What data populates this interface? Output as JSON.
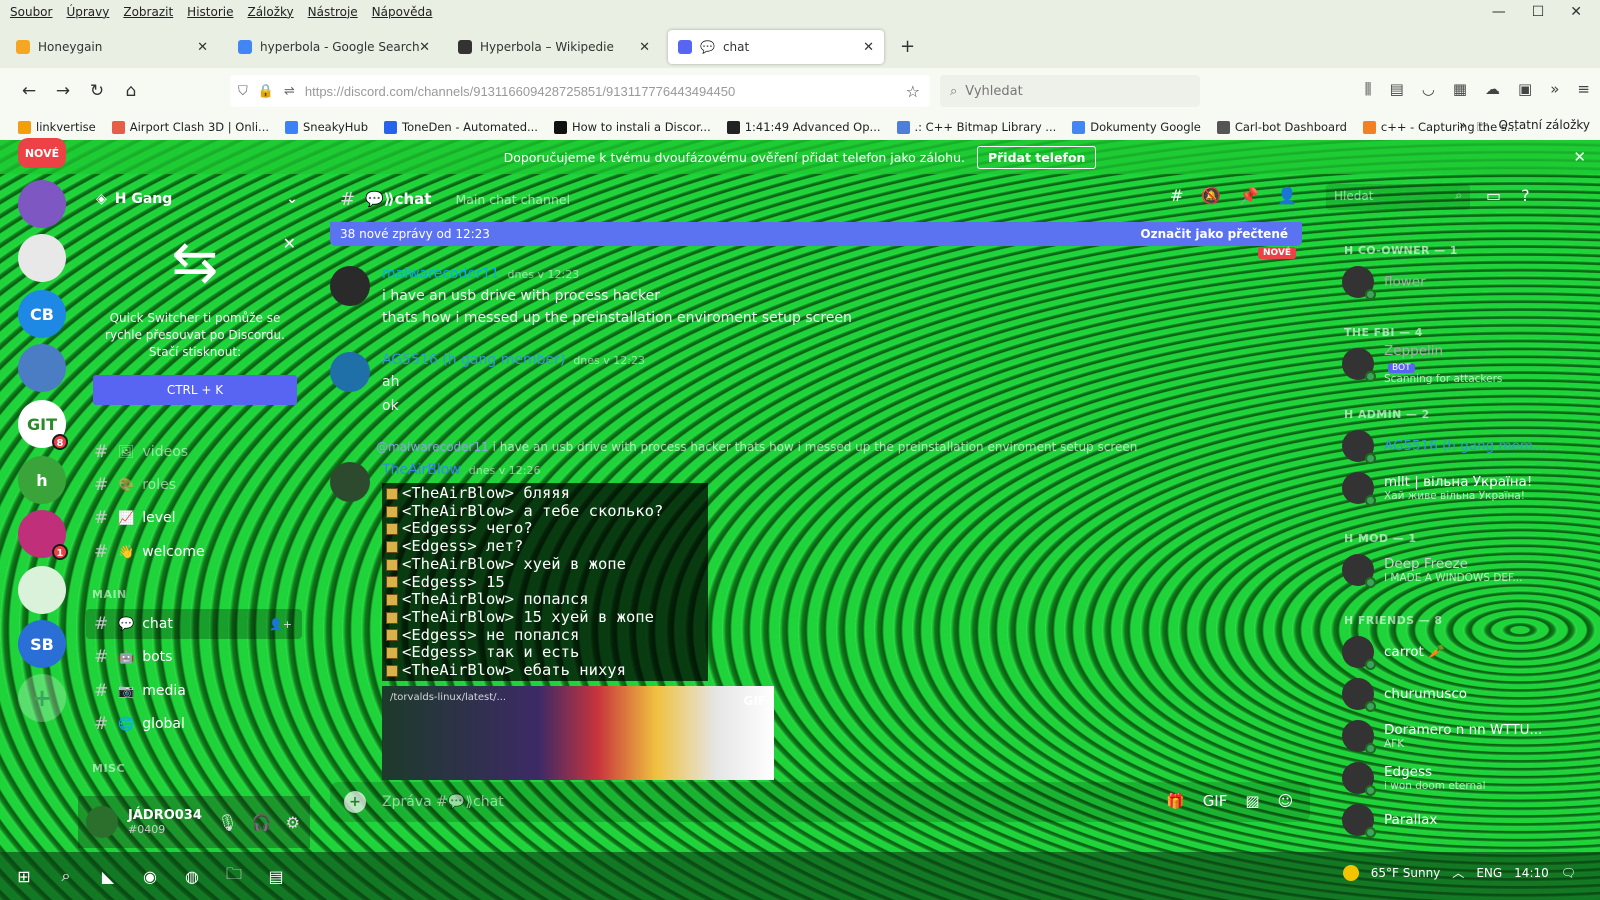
{
  "menu": [
    "Soubor",
    "Úpravy",
    "Zobrazit",
    "Historie",
    "Záložky",
    "Nástroje",
    "Nápověda"
  ],
  "window_controls": [
    "—",
    "☐",
    "✕"
  ],
  "tabs": [
    {
      "title": "Honeygain",
      "favicon": "honeygain-icon",
      "color": "#f5a623"
    },
    {
      "title": "hyperbola - Google Search",
      "favicon": "google-icon",
      "color": "#4285f4"
    },
    {
      "title": "Hyperbola – Wikipedie",
      "favicon": "wikipedia-icon",
      "color": "#333333"
    },
    {
      "title": "chat",
      "favicon": "discord-icon",
      "color": "#5865f2",
      "prefix": "💬"
    }
  ],
  "new_tab": "+",
  "url": "https://discord.com/channels/913116609428725851/913117776443494450",
  "search_placeholder": "Vyhledat",
  "bookmarks": [
    {
      "label": "linkvertise",
      "color": "#f59e0b"
    },
    {
      "label": "Airport Clash 3D | Onli...",
      "color": "#e85d4a"
    },
    {
      "label": "SneakyHub",
      "color": "#3b82f6"
    },
    {
      "label": "ToneDen - Automated...",
      "color": "#2563eb"
    },
    {
      "label": "How to instali a Discor...",
      "color": "#111111"
    },
    {
      "label": "1:41:49  Advanced Op...",
      "color": "#222222"
    },
    {
      "label": ".: C++ Bitmap Library ...",
      "color": "#4f7ddc"
    },
    {
      "label": "Dokumenty Google",
      "color": "#4285f4"
    },
    {
      "label": "Carl-bot Dashboard",
      "color": "#555555"
    },
    {
      "label": "c++ - Capturing the s...",
      "color": "#f48024"
    }
  ],
  "bookmarks_more": "»",
  "other_bookmarks": "Ostatní záložky",
  "notice": {
    "text": "Doporučujeme k tvému dvoufázovému ověření přidat telefon jako zálohu.",
    "button": "Přidat telefon",
    "close": "✕"
  },
  "guilds": [
    {
      "label": "NOVÉ",
      "color": "#ed4245"
    },
    {
      "label": "",
      "color": "#7e57c2"
    },
    {
      "label": "",
      "color": "#e8e8e8"
    },
    {
      "label": "CB",
      "color": "#1e88e5"
    },
    {
      "label": "",
      "color": "#4a7dc4"
    },
    {
      "label": "GIT",
      "color": "#ffffff",
      "badge": "8"
    },
    {
      "label": "h",
      "color": "#3aa33a"
    },
    {
      "label": "",
      "color": "#c0307a",
      "badge": "1"
    },
    {
      "label": "",
      "color": "#d9f2d9"
    },
    {
      "label": "SB",
      "color": "#2a6fd6"
    }
  ],
  "add_server": "+",
  "server": {
    "name": "H Gang",
    "chevron": "⌄"
  },
  "switcher": {
    "arrows": "⇆",
    "text": "Quick Switcher ti pomůže se rychle přesouvat po Discordu. Stačí stisknout:",
    "shortcut": "CTRL + K",
    "close": "✕"
  },
  "channels_top": [
    {
      "name": "videos",
      "emoji": "🖼",
      "dim": true
    },
    {
      "name": "roles",
      "emoji": "🎨",
      "dim": true
    },
    {
      "name": "level",
      "emoji": "📈",
      "dim": false
    },
    {
      "name": "welcome",
      "emoji": "👋",
      "dim": false
    }
  ],
  "category_main": "MAIN",
  "channels_main": [
    {
      "name": "chat",
      "emoji": "💬",
      "active": true
    },
    {
      "name": "bots",
      "emoji": "🤖",
      "active": false
    },
    {
      "name": "media",
      "emoji": "📷",
      "active": false
    },
    {
      "name": "global",
      "emoji": "🌐",
      "active": false
    }
  ],
  "category_misc": "MISC",
  "user": {
    "name": "JÁDRO034",
    "tag": "#0409"
  },
  "chat_header": {
    "name": "💬⟫chat",
    "topic": "Main chat channel"
  },
  "member_search": "Hledat",
  "new_messages": {
    "text": "38 nové zprávy od 12:23",
    "mark": "Označit jako přečtené",
    "tag": "NOVÉ"
  },
  "messages": [
    {
      "author": "malwarecoder11",
      "time": "dnes v 12:23",
      "color": "#00b0f4",
      "lines": [
        "i have an usb drive with process hacker",
        "thats how i messed up the preinstallation enviroment setup screen"
      ]
    },
    {
      "author": "AG5516 (h gang member)",
      "time": "dnes v 12:23",
      "color": "#3498db",
      "lines": [
        "ah",
        "ok"
      ]
    },
    {
      "author": "TheAirBlow",
      "time": "dnes v 12:26",
      "color": "#3b82f6",
      "lines": []
    }
  ],
  "reply": {
    "mention": "@malwarecoder11",
    "text": " i have an usb drive with process hacker thats how i messed up the preinstallation enviroment setup screen"
  },
  "mc_chat": [
    "<TheAirBlow> бляяя",
    "<TheAirBlow> а тебе сколько?",
    "<Edgess> чего?",
    "<Edgess> лет?",
    "<TheAirBlow> хуей в жопе",
    "<Edgess> 15",
    "<TheAirBlow> попался",
    "<TheAirBlow> 15 хуей в жопе",
    "<Edgess> не попался",
    "<Edgess> так и есть",
    "<TheAirBlow> ебать нихуя"
  ],
  "gif": {
    "tag": "GIF",
    "url": "/torvalds-linux/latest/..."
  },
  "composer_placeholder": "Zpráva #💬⟫chat",
  "member_groups": [
    {
      "label": "H CO-OWNER — 1",
      "members": [
        {
          "name": "flower",
          "status": "",
          "color": "#aaaaaa"
        }
      ]
    },
    {
      "label": "THE FBI — 4",
      "members": [
        {
          "name": "Zeppelin",
          "status": "Scanning for attackers",
          "color": "#aaaaaa",
          "bot": "BOT"
        }
      ]
    },
    {
      "label": "H ADMIN — 2",
      "members": [
        {
          "name": "AG5516 (h gang mem...",
          "status": "",
          "color": "#3498db"
        },
        {
          "name": "mllt | вільна Україна!",
          "status": "Хай живе вільна Україна!",
          "color": "#ffffff"
        }
      ]
    },
    {
      "label": "H MOD — 1",
      "members": [
        {
          "name": "Deep Freeze",
          "status": "I MADE A WINDOWS DEF...",
          "color": "#cfcfcf"
        }
      ]
    },
    {
      "label": "H FRIENDS — 8",
      "members": [
        {
          "name": "carrot 🥕",
          "status": "",
          "color": "#ffffff"
        },
        {
          "name": "churumusco",
          "status": "",
          "color": "#ffffff"
        },
        {
          "name": "Doramero n nn WTTU...",
          "status": "AFK",
          "color": "#ffffff"
        },
        {
          "name": "Edgess",
          "status": "i won doom eternal",
          "color": "#ffffff"
        },
        {
          "name": "Parallax",
          "status": "",
          "color": "#ffffff"
        }
      ]
    }
  ],
  "taskbar": {
    "weather": "65°F  Sunny",
    "lang": "ENG",
    "time": "14:10"
  }
}
